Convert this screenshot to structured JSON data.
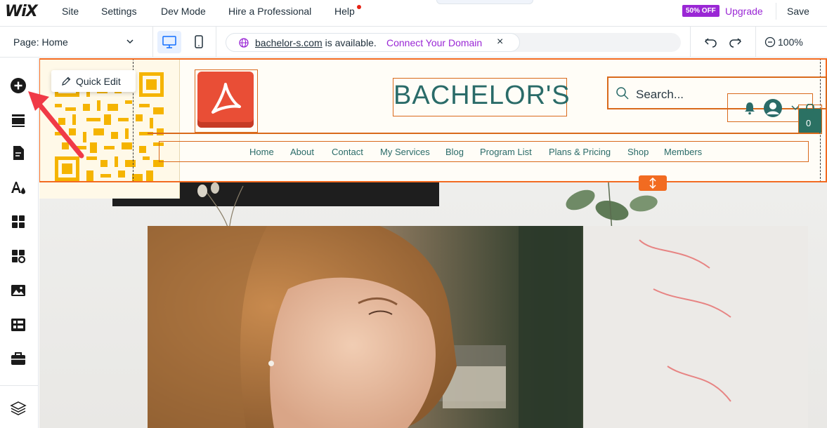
{
  "topbar": {
    "logo": "WiX",
    "menu": [
      "Site",
      "Settings",
      "Dev Mode",
      "Hire a Professional",
      "Help"
    ],
    "badge": "50% OFF",
    "upgrade": "Upgrade",
    "save": "Save"
  },
  "toolbar": {
    "page_select": "Page: Home",
    "domain_name": "bachelor-s.com",
    "domain_status": "is available.",
    "connect": "Connect Your Domain",
    "close": "×",
    "zoom": "100%"
  },
  "sidebar": {
    "items": [
      "add-icon",
      "sections-icon",
      "pages-icon",
      "design-icon",
      "apps-icon",
      "add-apps-icon",
      "media-icon",
      "cms-icon",
      "business-icon",
      "layers-icon"
    ]
  },
  "quick_edit": {
    "label": "Quick Edit"
  },
  "site": {
    "brand": "BACHELOR'S",
    "search_placeholder": "Search...",
    "cart_count": "0",
    "nav": [
      "Home",
      "About",
      "Contact",
      "My Services",
      "Blog",
      "Program List",
      "Plans & Pricing",
      "Shop",
      "Members"
    ]
  },
  "colors": {
    "accent_purple": "#9a27d5",
    "frame_orange": "#f26b21",
    "brand_teal": "#2a6b68",
    "qr_yellow": "#f5b400",
    "arrow_red": "#f03a47"
  }
}
